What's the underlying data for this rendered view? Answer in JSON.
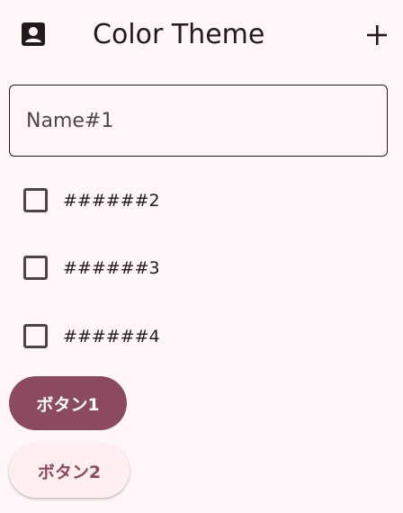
{
  "app_bar": {
    "leading_icon": "account-box-icon",
    "title": "Color Theme",
    "action_icon": "add-icon"
  },
  "text_field": {
    "label": "Name#1"
  },
  "checkboxes": [
    {
      "label": "######2",
      "checked": false
    },
    {
      "label": "######3",
      "checked": false
    },
    {
      "label": "######4",
      "checked": false
    }
  ],
  "buttons": {
    "primary_label": "ボタン1",
    "secondary_label": "ボタン2"
  },
  "colors": {
    "background": "#fff7f7",
    "primary": "#8b4a60",
    "on_surface": "#221a1c",
    "outline": "#514347",
    "elevated_surface": "#ffeff0"
  }
}
